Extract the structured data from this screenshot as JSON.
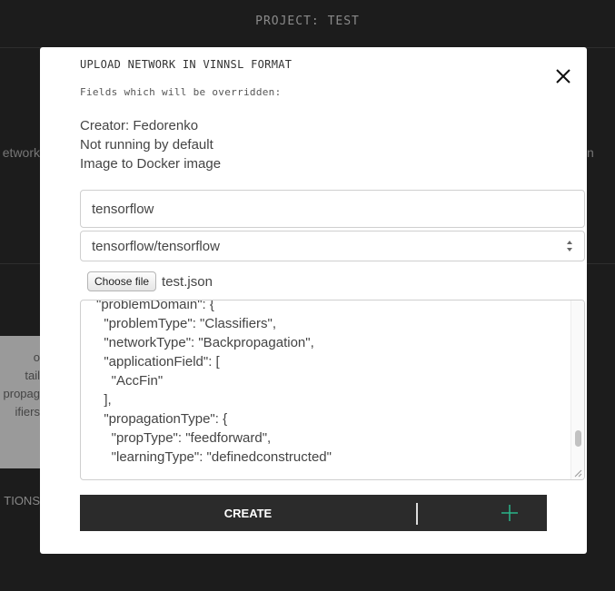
{
  "background": {
    "project_title": "PROJECT: TEST",
    "left_partial_text": "etwork",
    "right_partial_text": "n",
    "card_lines": [
      "o",
      "tail",
      "propag",
      "ifiers"
    ],
    "bottom_partial_text": "TIONS"
  },
  "modal": {
    "title": "UPLOAD NETWORK IN VINNSL FORMAT",
    "subtitle": "Fields which will be overridden:",
    "info_lines": [
      "Creator: Fedorenko",
      "Not running by default",
      "Image to Docker image"
    ],
    "name_input": {
      "value": "tensorflow"
    },
    "image_select": {
      "selected": "tensorflow/tensorflow"
    },
    "file": {
      "button_label": "Choose file",
      "file_name": "test.json"
    },
    "json_lines": [
      "\"problemDomain\": {",
      "  \"problemType\": \"Classifiers\",",
      "  \"networkType\": \"Backpropagation\",",
      "  \"applicationField\": [",
      "    \"AccFin\"",
      "  ],",
      "  \"propagationType\": {",
      "    \"propType\": \"feedforward\",",
      "    \"learningType\": \"definedconstructed\""
    ],
    "create_label": "CREATE",
    "icons": {
      "close": "close-icon",
      "add": "plus-icon"
    },
    "colors": {
      "bar": "#2b2b2b",
      "accent": "#2bb58a"
    }
  }
}
